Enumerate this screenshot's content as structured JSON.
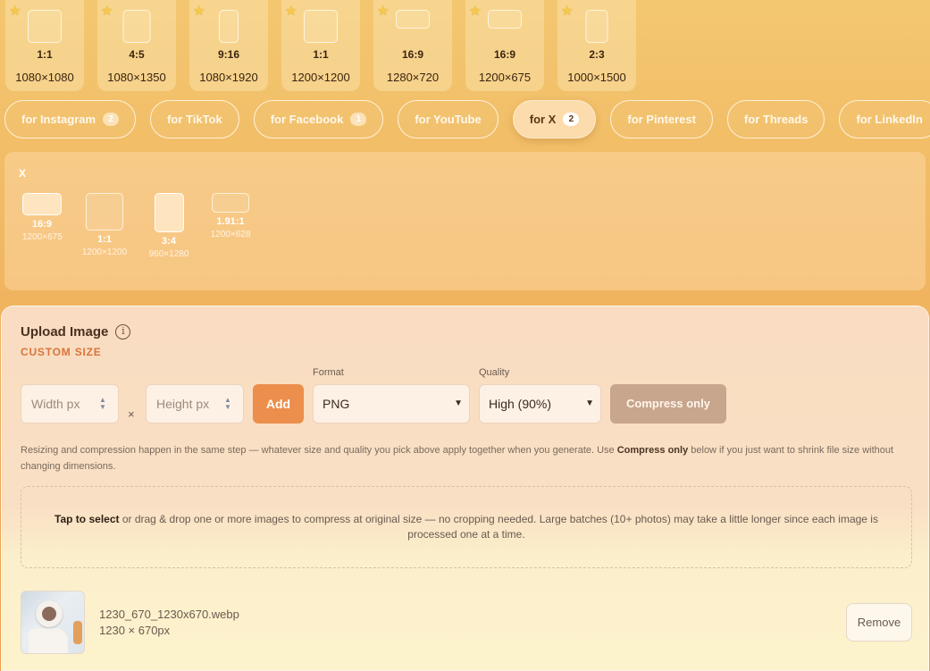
{
  "presets": [
    {
      "ratio": "1:1",
      "dims": "1080×1080"
    },
    {
      "ratio": "4:5",
      "dims": "1080×1350"
    },
    {
      "ratio": "9:16",
      "dims": "1080×1920"
    },
    {
      "ratio": "1:1",
      "dims": "1200×1200"
    },
    {
      "ratio": "16:9",
      "dims": "1280×720"
    },
    {
      "ratio": "16:9",
      "dims": "1200×675"
    },
    {
      "ratio": "2:3",
      "dims": "1000×1500"
    }
  ],
  "platforms": [
    {
      "label": "for Instagram",
      "badge": "2"
    },
    {
      "label": "for TikTok",
      "badge": ""
    },
    {
      "label": "for Facebook",
      "badge": "1"
    },
    {
      "label": "for YouTube",
      "badge": ""
    },
    {
      "label": "for X",
      "badge": "2",
      "active": true
    },
    {
      "label": "for Pinterest",
      "badge": ""
    },
    {
      "label": "for Threads",
      "badge": ""
    },
    {
      "label": "for LinkedIn",
      "badge": ""
    }
  ],
  "x_panel": {
    "title": "X",
    "presets": [
      {
        "ratio": "16:9",
        "dims": "1200×675",
        "selected": true
      },
      {
        "ratio": "1:1",
        "dims": "1200×1200",
        "selected": false
      },
      {
        "ratio": "3:4",
        "dims": "960×1280",
        "selected": true
      },
      {
        "ratio": "1.91:1",
        "dims": "1200×628",
        "selected": false
      }
    ]
  },
  "upload": {
    "title": "Upload Image",
    "info_icon": "info-icon",
    "subtitle": "CUSTOM SIZE",
    "width_placeholder": "Width px",
    "height_placeholder": "Height px",
    "times": "×",
    "add_label": "Add",
    "format_label": "Format",
    "format_value": "PNG",
    "quality_label": "Quality",
    "quality_value": "High (90%)",
    "compress_label": "Compress only",
    "help_pre": "Resizing and compression happen in the same step — whatever size and quality you pick above apply together when you generate. Use ",
    "help_bold": "Compress only",
    "help_post": " below if you just want to shrink file size without changing dimensions.",
    "drop_bold": "Tap to select",
    "drop_text": " or drag & drop one or more images to compress at original size — no cropping needed. Large batches (10+ photos) may take a little longer since each image is processed one at a time."
  },
  "file": {
    "name": "1230_670_1230x670.webp",
    "dims": "1230 × 670px",
    "remove_label": "Remove"
  },
  "colors": {
    "accent": "#ec8e4c",
    "subtitle": "#d9743a",
    "star": "#f7c948"
  }
}
